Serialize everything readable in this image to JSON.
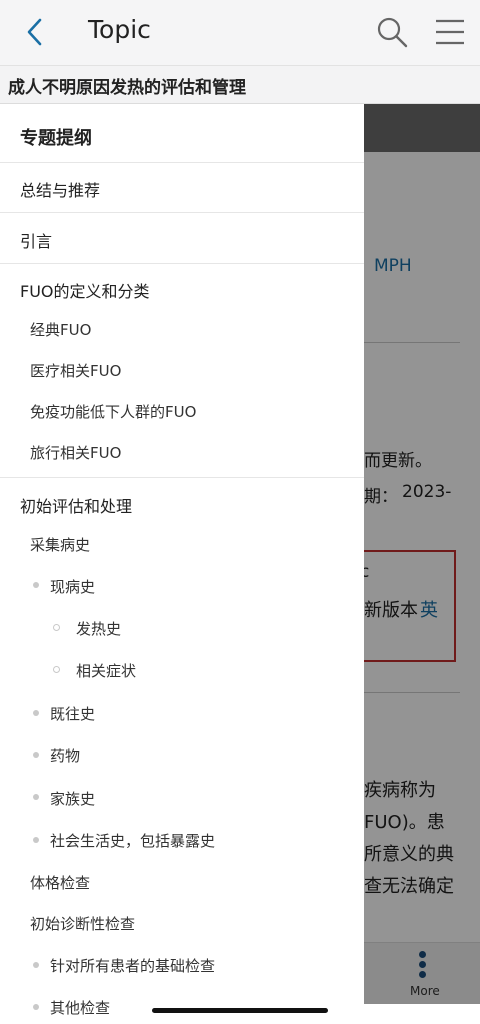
{
  "appbar": {
    "title": "Topic",
    "back_icon": "chevron-left-icon",
    "search_icon": "search-icon",
    "menu_icon": "hamburger-menu-icon"
  },
  "topic": {
    "title": "成人不明原因发热的评估和管理"
  },
  "background_article": {
    "fragments": [
      "MPH",
      "而更新。",
      "期：",
      "2023-",
      "新版本",
      "英",
      "疾病称为",
      "FUO)。患",
      "所意义的典",
      "查无法确定"
    ],
    "more_label": "More"
  },
  "outline": {
    "title": "专题提纲",
    "items": [
      {
        "label": "总结与推荐"
      },
      {
        "label": "引言"
      },
      {
        "label": "FUO的定义和分类"
      },
      {
        "label": "经典FUO"
      },
      {
        "label": "医疗相关FUO"
      },
      {
        "label": "免疫功能低下人群的FUO"
      },
      {
        "label": "旅行相关FUO"
      },
      {
        "label": "初始评估和处理"
      },
      {
        "label": "采集病史"
      },
      {
        "label": "现病史"
      },
      {
        "label": "发热史"
      },
      {
        "label": "相关症状"
      },
      {
        "label": "既往史"
      },
      {
        "label": "药物"
      },
      {
        "label": "家族史"
      },
      {
        "label": "社会生活史，包括暴露史"
      },
      {
        "label": "体格检查"
      },
      {
        "label": "初始诊断性检查"
      },
      {
        "label": "针对所有患者的基础检查"
      },
      {
        "label": "其他检查"
      }
    ]
  }
}
